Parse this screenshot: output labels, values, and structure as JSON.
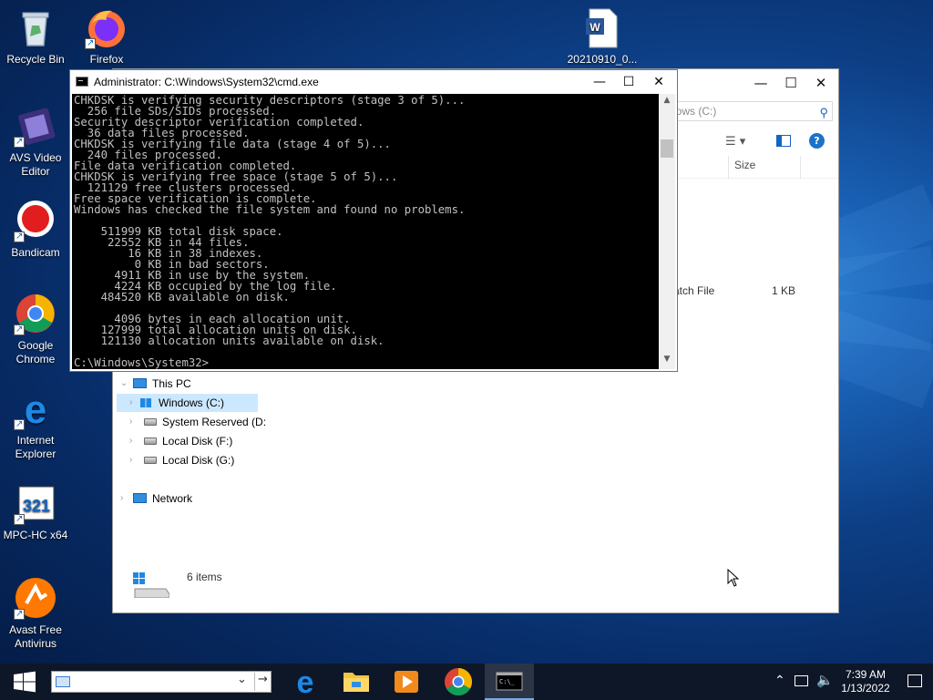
{
  "desktop": {
    "icons": [
      {
        "label": "Recycle Bin"
      },
      {
        "label": "Firefox"
      },
      {
        "label": "AVS Video Editor"
      },
      {
        "label": "Bandicam"
      },
      {
        "label": "Google Chrome"
      },
      {
        "label": "Internet Explorer"
      },
      {
        "label": "MPC-HC x64"
      },
      {
        "label": "Avast Free Antivirus"
      },
      {
        "label": "20210910_0..."
      }
    ]
  },
  "explorer": {
    "search_placeholder": "dows (C:)",
    "column_size": "Size",
    "file_row": {
      "type": "atch File",
      "size": "1 KB"
    },
    "nav": {
      "this_pc": "This PC",
      "drives": [
        "Windows (C:)",
        "System Reserved (D:",
        "Local Disk (F:)",
        "Local Disk (G:)"
      ],
      "network": "Network"
    },
    "status": "6 items"
  },
  "cmd": {
    "title": "Administrator: C:\\Windows\\System32\\cmd.exe",
    "lines": [
      "CHKDSK is verifying security descriptors (stage 3 of 5)...",
      "  256 file SDs/SIDs processed.",
      "Security descriptor verification completed.",
      "  36 data files processed.",
      "CHKDSK is verifying file data (stage 4 of 5)...",
      "  240 files processed.",
      "File data verification completed.",
      "CHKDSK is verifying free space (stage 5 of 5)...",
      "  121129 free clusters processed.",
      "Free space verification is complete.",
      "Windows has checked the file system and found no problems.",
      "",
      "    511999 KB total disk space.",
      "     22552 KB in 44 files.",
      "        16 KB in 38 indexes.",
      "         0 KB in bad sectors.",
      "      4911 KB in use by the system.",
      "      4224 KB occupied by the log file.",
      "    484520 KB available on disk.",
      "",
      "      4096 bytes in each allocation unit.",
      "    127999 total allocation units on disk.",
      "    121130 allocation units available on disk.",
      "",
      "C:\\Windows\\System32>"
    ]
  },
  "taskbar": {
    "clock_time": "7:39 AM",
    "clock_date": "1/13/2022",
    "apps": [
      "edge",
      "file-explorer",
      "media-player",
      "chrome",
      "cmd"
    ]
  },
  "colors": {
    "console_bg": "#000000",
    "console_fg": "#c0c0c0",
    "accent": "#0078d7",
    "taskbar": "#0e1727"
  }
}
